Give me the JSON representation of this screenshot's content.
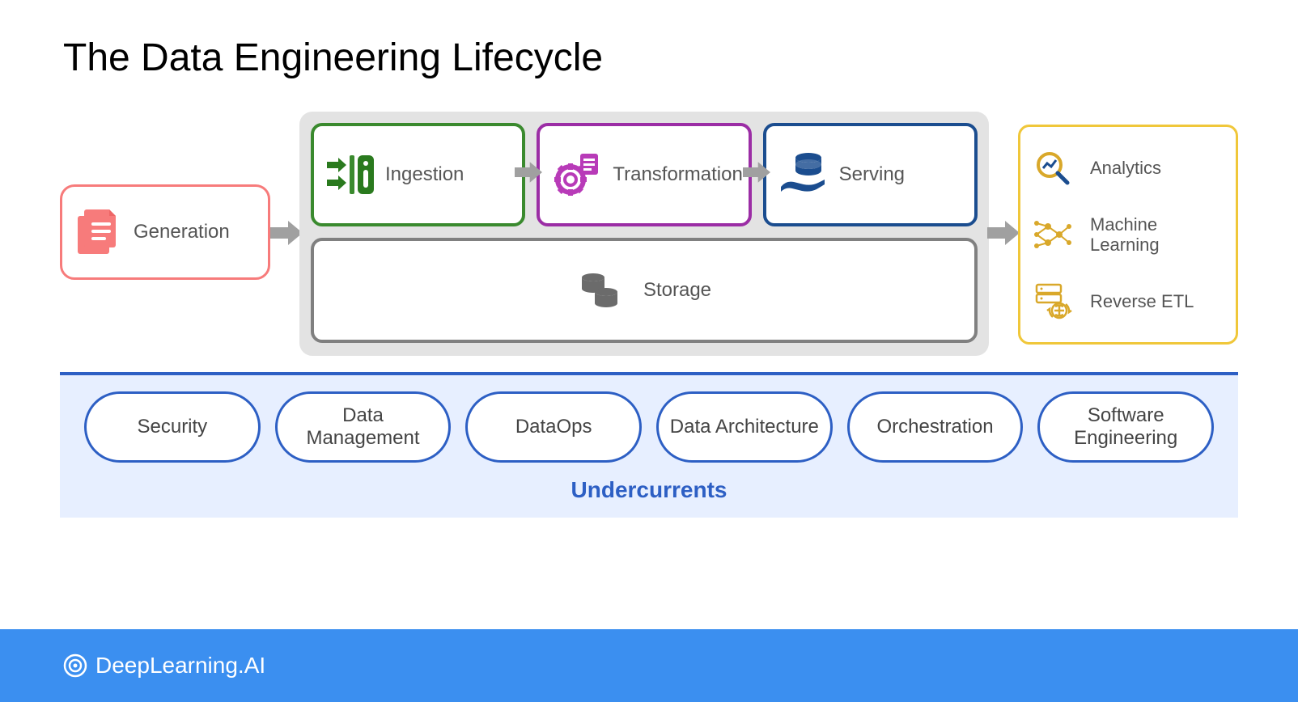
{
  "title": "The Data Engineering Lifecycle",
  "stages": {
    "generation": {
      "label": "Generation",
      "color": "#f77b7b"
    },
    "ingestion": {
      "label": "Ingestion",
      "color": "#3a8a2e"
    },
    "transformation": {
      "label": "Transformation",
      "color": "#9b2da5"
    },
    "serving": {
      "label": "Serving",
      "color": "#1b4d8f"
    },
    "storage": {
      "label": "Storage",
      "color": "#808080"
    }
  },
  "outputs": {
    "color": "#f0c73a",
    "items": [
      {
        "label": "Analytics"
      },
      {
        "label": "Machine Learning"
      },
      {
        "label": "Reverse ETL"
      }
    ]
  },
  "undercurrents": {
    "label": "Undercurrents",
    "items": [
      "Security",
      "Data Management",
      "DataOps",
      "Data Architecture",
      "Orchestration",
      "Software Engineering"
    ]
  },
  "footer": {
    "brand": "DeepLearning.AI"
  },
  "colors": {
    "blue": "#2d5fc4",
    "lightblue": "#e7efff",
    "footer": "#3b8ff0",
    "arrow": "#a0a0a0"
  }
}
